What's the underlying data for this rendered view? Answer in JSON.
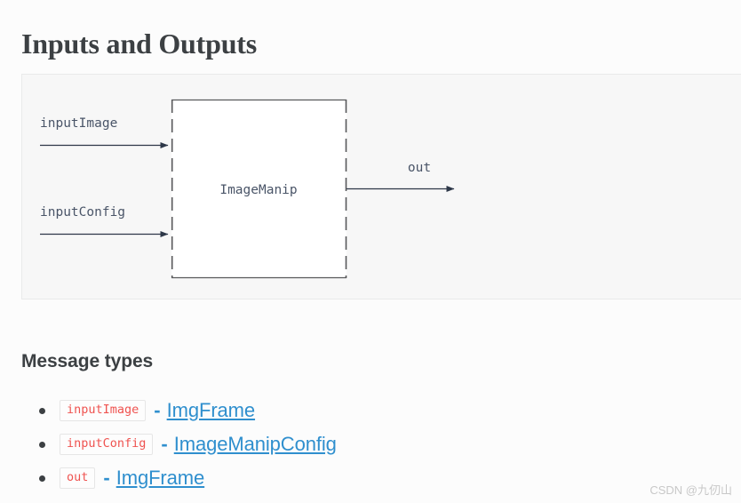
{
  "page": {
    "title": "Inputs and Outputs",
    "background_color": "#fcfcfc"
  },
  "diagram": {
    "panel_background": "#f7f7f7",
    "panel_border_color": "#e9eaea",
    "node": {
      "label": "ImageManip",
      "fill": "#ffffff",
      "border_color": "#58595b",
      "side_border_style": "dashed"
    },
    "inputs": [
      {
        "label": "inputImage",
        "arrow": "arrow-right"
      },
      {
        "label": "inputConfig",
        "arrow": "arrow-right"
      }
    ],
    "outputs": [
      {
        "label": "out",
        "arrow": "arrow-right"
      }
    ]
  },
  "message_types": {
    "heading": "Message types",
    "separator": "-",
    "code_color": "#ef5350",
    "link_color": "#2f8fce",
    "items": [
      {
        "name": "inputImage",
        "type": "ImgFrame"
      },
      {
        "name": "inputConfig",
        "type": "ImageManipConfig"
      },
      {
        "name": "out",
        "type": "ImgFrame"
      }
    ]
  },
  "watermark": {
    "text": "CSDN @九仞山"
  }
}
